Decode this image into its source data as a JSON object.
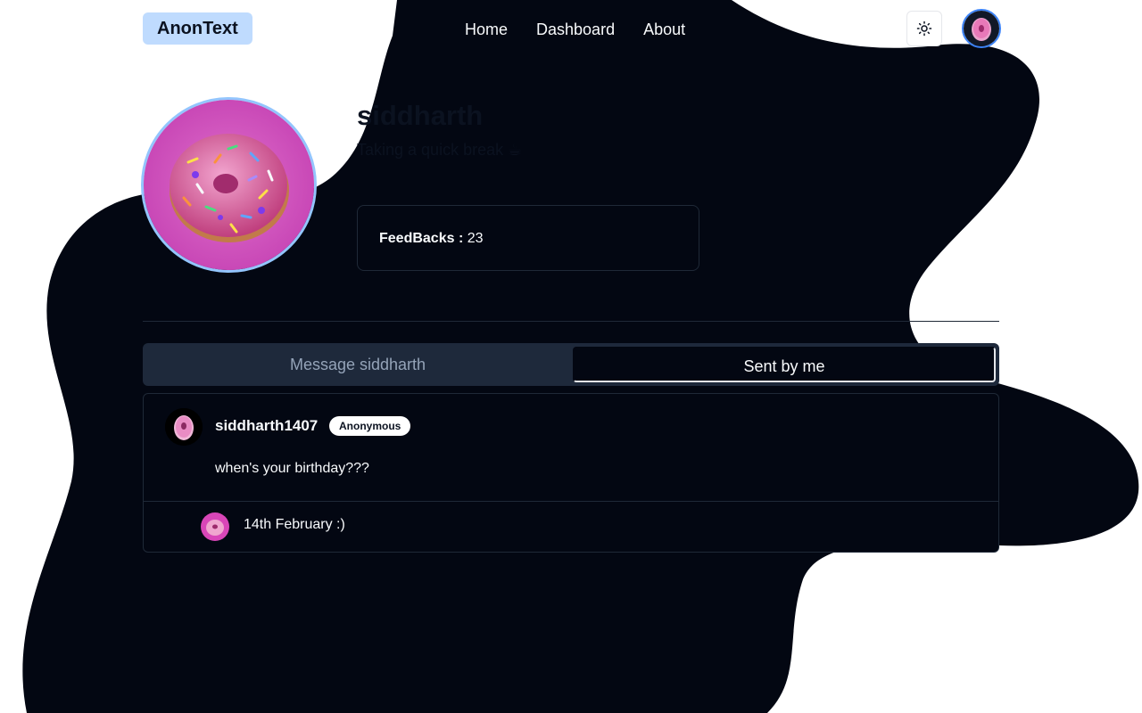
{
  "app": {
    "logo": "AnonText"
  },
  "nav": {
    "items": [
      {
        "label": "Home"
      },
      {
        "label": "Dashboard"
      },
      {
        "label": "About"
      }
    ]
  },
  "header": {
    "theme_toggle_icon": "sun-icon",
    "avatar_icon": "donut-avatar-icon"
  },
  "profile": {
    "name": "siddharth",
    "status": "Taking a quick break ☕",
    "feedbacks_label": "FeedBacks :",
    "feedbacks_count": "23"
  },
  "tabs": {
    "message": "Message siddharth",
    "sent": "Sent by me",
    "active": "Sent by me"
  },
  "messages": [
    {
      "username": "siddharth1407",
      "badge": "Anonymous",
      "text": "when's your birthday???",
      "reply": "14th February :)"
    }
  ],
  "colors": {
    "background": "#ffffff",
    "blob": "#030712",
    "logo_bg": "#bfdbfe",
    "accent_ring": "#93c5fd",
    "donut_pink": "#d946b8"
  }
}
